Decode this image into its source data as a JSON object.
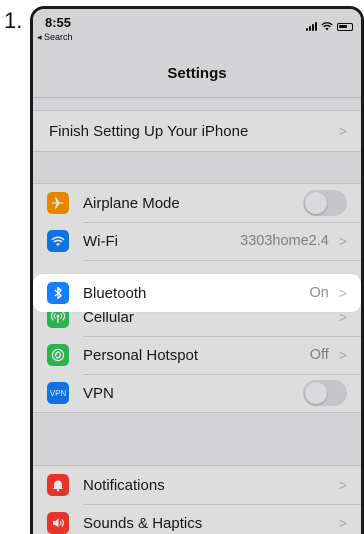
{
  "step_number": "1.",
  "status_bar": {
    "time": "8:55",
    "back_label": "◂ Search"
  },
  "nav": {
    "title": "Settings"
  },
  "finish_setup": {
    "label": "Finish Setting Up Your iPhone"
  },
  "connectivity": [
    {
      "label": "Airplane Mode",
      "icon": "airplane-icon",
      "color": "#ff9500",
      "control": "toggle",
      "value": ""
    },
    {
      "label": "Wi-Fi",
      "icon": "wifi-icon",
      "color": "#147efb",
      "control": "chevron",
      "value": "3303home2.4"
    },
    {
      "label": "Bluetooth",
      "icon": "bluetooth-icon",
      "color": "#147efb",
      "control": "chevron",
      "value": "On"
    },
    {
      "label": "Cellular",
      "icon": "antenna-icon",
      "color": "#34c759",
      "control": "chevron",
      "value": ""
    },
    {
      "label": "Personal Hotspot",
      "icon": "hotspot-icon",
      "color": "#34c759",
      "control": "chevron",
      "value": "Off"
    },
    {
      "label": "VPN",
      "icon": "vpn-icon",
      "color": "#147efb",
      "control": "toggle",
      "value": ""
    }
  ],
  "notifications_group": [
    {
      "label": "Notifications",
      "icon": "bell-icon",
      "color": "#ff3b30"
    },
    {
      "label": "Sounds & Haptics",
      "icon": "speaker-icon",
      "color": "#ff3b30"
    }
  ],
  "icon_text": {
    "vpn": "VPN"
  }
}
